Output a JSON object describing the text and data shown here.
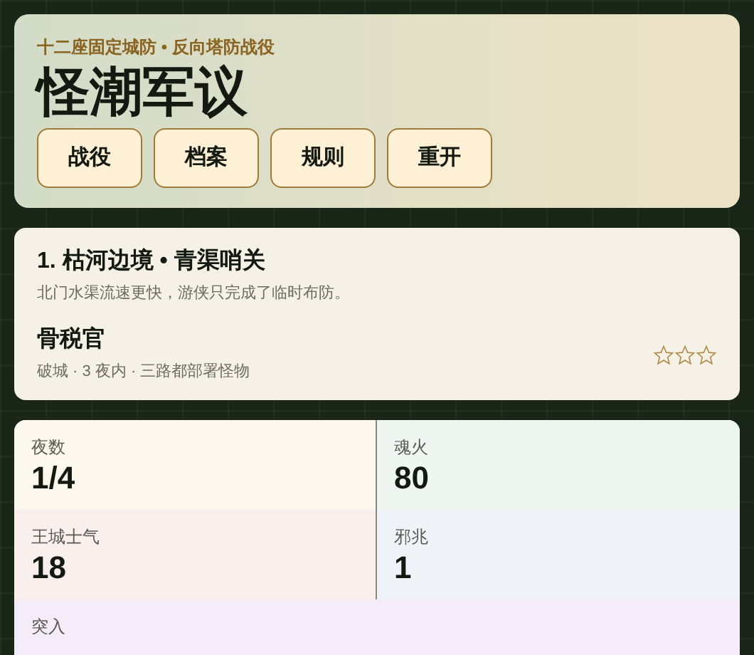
{
  "header": {
    "eyebrow": "十二座固定城防 • 反向塔防战役",
    "title": "怪潮军议",
    "buttons": [
      "战役",
      "档案",
      "规则",
      "重开"
    ]
  },
  "level_card": {
    "title": "1. 枯河边境 • 青渠哨关",
    "description": "北门水渠流速更快，游侠只完成了临时布防。",
    "boss": "骨税官",
    "objective": "破城 · 3 夜内 · 三路都部署怪物",
    "stars": 0
  },
  "stats": [
    {
      "label": "夜数",
      "value": "1/4",
      "color": "#fdf8ee"
    },
    {
      "label": "魂火",
      "value": "80",
      "color": "#eff5f0"
    },
    {
      "label": "王城士气",
      "value": "18",
      "color": "#f9efed"
    },
    {
      "label": "邪兆",
      "value": "1",
      "color": "#eff3f8"
    },
    {
      "label": "突入",
      "color": "#f4ecf8"
    }
  ]
}
